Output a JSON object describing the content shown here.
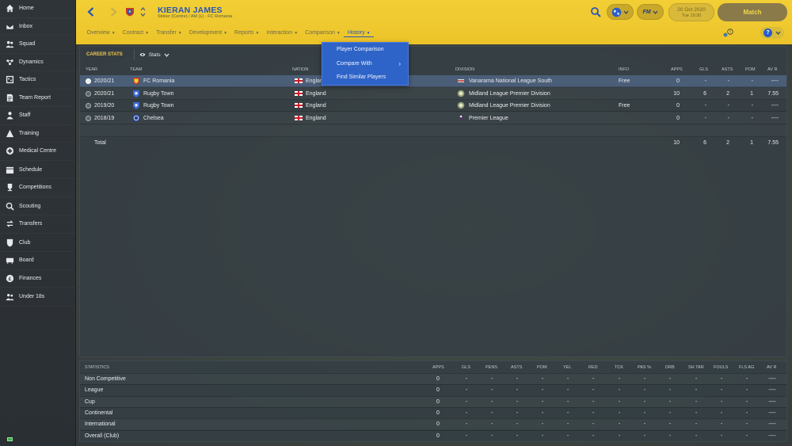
{
  "sidebar": {
    "items": [
      {
        "label": "Home",
        "icon": "home-icon"
      },
      {
        "label": "Inbox",
        "icon": "inbox-icon"
      },
      {
        "label": "Squad",
        "icon": "squad-icon"
      },
      {
        "label": "Dynamics",
        "icon": "dynamics-icon"
      },
      {
        "label": "Tactics",
        "icon": "tactics-icon"
      },
      {
        "label": "Team Report",
        "icon": "report-icon"
      },
      {
        "label": "Staff",
        "icon": "staff-icon"
      },
      {
        "label": "Training",
        "icon": "training-icon"
      },
      {
        "label": "Medical Centre",
        "icon": "medical-icon"
      },
      {
        "label": "Schedule",
        "icon": "schedule-icon"
      },
      {
        "label": "Competitions",
        "icon": "trophy-icon"
      },
      {
        "label": "Scouting",
        "icon": "scouting-icon"
      },
      {
        "label": "Transfers",
        "icon": "transfers-icon"
      },
      {
        "label": "Club",
        "icon": "club-icon"
      },
      {
        "label": "Board",
        "icon": "board-icon"
      },
      {
        "label": "Finances",
        "icon": "finances-icon"
      },
      {
        "label": "Under 18s",
        "icon": "under18-icon"
      }
    ]
  },
  "header": {
    "player_name": "KIERAN JAMES",
    "player_sub": "Striker (Centre) / AM (L) - FC Romania",
    "date": "20 Oct 2020",
    "time": "Tue 19:30",
    "match_label": "Match",
    "fm_label": "FM",
    "accent": "#2a55b8",
    "bar_color": "#f2cf35"
  },
  "menu": [
    {
      "label": "Overview"
    },
    {
      "label": "Contract"
    },
    {
      "label": "Transfer"
    },
    {
      "label": "Development"
    },
    {
      "label": "Reports"
    },
    {
      "label": "Interaction"
    },
    {
      "label": "Comparison"
    },
    {
      "label": "History"
    }
  ],
  "dropdown": {
    "items": [
      "Player Comparison",
      "Compare With",
      "Find Similar Players"
    ],
    "color": "#2e63c8"
  },
  "career": {
    "title": "CAREER STATS",
    "view": "Stats",
    "columns": {
      "year": "YEAR",
      "team": "TEAM",
      "nation": "NATION",
      "division": "DIVISION",
      "info": "INFO",
      "apps": "APPS",
      "gls": "GLS",
      "asts": "ASTS",
      "pom": "POM",
      "avr": "AV R"
    },
    "rows": [
      {
        "year": "2020/21",
        "team": "FC Romania",
        "nation": "England",
        "division": "Vanarama National League South",
        "info": "Free",
        "apps": "0",
        "gls": "-",
        "asts": "-",
        "pom": "-",
        "avr": "----"
      },
      {
        "year": "2020/21",
        "team": "Rugby Town",
        "nation": "England",
        "division": "Midland League Premier Division",
        "info": "",
        "apps": "10",
        "gls": "6",
        "asts": "2",
        "pom": "1",
        "avr": "7.55"
      },
      {
        "year": "2019/20",
        "team": "Rugby Town",
        "nation": "England",
        "division": "Midland League Premier Division",
        "info": "Free",
        "apps": "0",
        "gls": "-",
        "asts": "-",
        "pom": "-",
        "avr": "----"
      },
      {
        "year": "2018/19",
        "team": "Chelsea",
        "nation": "England",
        "division": "Premier League",
        "info": "",
        "apps": "0",
        "gls": "-",
        "asts": "-",
        "pom": "-",
        "avr": "----"
      }
    ],
    "total": {
      "label": "Total",
      "apps": "10",
      "gls": "6",
      "asts": "2",
      "pom": "1",
      "avr": "7.55"
    }
  },
  "statistics": {
    "columns": [
      "STATISTICS",
      "APPS",
      "GLS",
      "PENS",
      "ASTS",
      "POM",
      "YEL",
      "RED",
      "TCK",
      "PAS %",
      "DRB",
      "SH TAR",
      "FOULS",
      "FLS AG",
      "AV R"
    ],
    "rows": [
      {
        "label": "Non Competitive",
        "apps": "0",
        "gls": "-",
        "pens": "-",
        "asts": "-",
        "pom": "-",
        "yel": "-",
        "red": "-",
        "tck": "-",
        "pas": "-",
        "drb": "-",
        "shtar": "-",
        "fouls": "-",
        "flsag": "-",
        "avr": "----"
      },
      {
        "label": "League",
        "apps": "0",
        "gls": "-",
        "pens": "-",
        "asts": "-",
        "pom": "-",
        "yel": "-",
        "red": "-",
        "tck": "-",
        "pas": "-",
        "drb": "-",
        "shtar": "-",
        "fouls": "-",
        "flsag": "-",
        "avr": "----"
      },
      {
        "label": "Cup",
        "apps": "0",
        "gls": "-",
        "pens": "-",
        "asts": "-",
        "pom": "-",
        "yel": "-",
        "red": "-",
        "tck": "-",
        "pas": "-",
        "drb": "-",
        "shtar": "-",
        "fouls": "-",
        "flsag": "-",
        "avr": "----"
      },
      {
        "label": "Continental",
        "apps": "0",
        "gls": "-",
        "pens": "-",
        "asts": "-",
        "pom": "-",
        "yel": "-",
        "red": "-",
        "tck": "-",
        "pas": "-",
        "drb": "-",
        "shtar": "-",
        "fouls": "-",
        "flsag": "-",
        "avr": "----"
      },
      {
        "label": "International",
        "apps": "0",
        "gls": "-",
        "pens": "-",
        "asts": "-",
        "pom": "-",
        "yel": "-",
        "red": "-",
        "tck": "-",
        "pas": "-",
        "drb": "-",
        "shtar": "-",
        "fouls": "-",
        "flsag": "-",
        "avr": "----"
      },
      {
        "label": "Overall (Club)",
        "apps": "0",
        "gls": "-",
        "pens": "-",
        "asts": "-",
        "pom": "-",
        "yel": "-",
        "red": "-",
        "tck": "-",
        "pas": "-",
        "drb": "-",
        "shtar": "-",
        "fouls": "-",
        "flsag": "-",
        "avr": "----"
      }
    ]
  }
}
